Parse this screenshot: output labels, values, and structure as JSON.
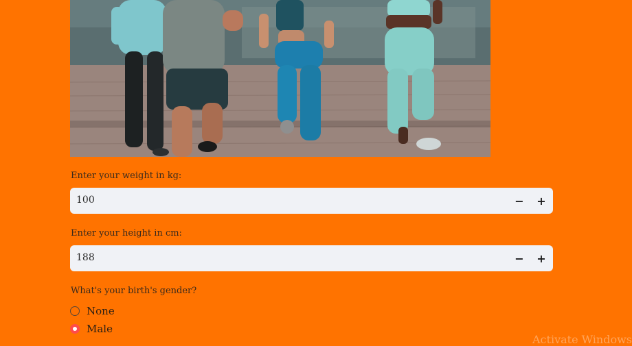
{
  "hero": {
    "image_name": "runners-photo"
  },
  "weight": {
    "label": "Enter your weight in kg:",
    "value": "100",
    "decrement": "−",
    "increment": "+"
  },
  "height": {
    "label": "Enter your height in cm:",
    "value": "188",
    "decrement": "−",
    "increment": "+"
  },
  "gender": {
    "label": "What's your birth's gender?",
    "options": [
      {
        "label": "None",
        "selected": false
      },
      {
        "label": "Male",
        "selected": true
      }
    ]
  },
  "watermark": {
    "text": "Activate Windows"
  },
  "colors": {
    "background": "#FF7300",
    "input_bg": "#F0F2F6",
    "radio_accent": "#FF4B4B"
  }
}
